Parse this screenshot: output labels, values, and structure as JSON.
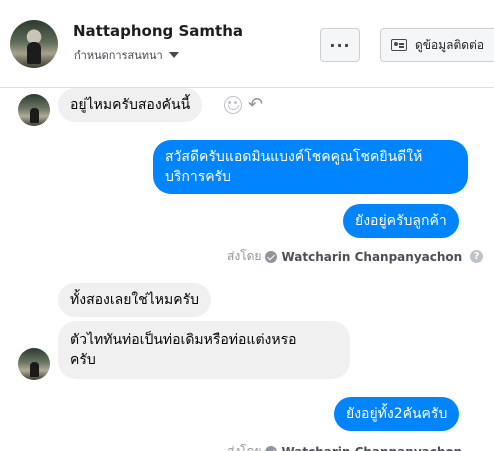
{
  "header": {
    "contact_name": "Nattaphong Samtha",
    "subtitle": "กำหนดการสนทนา",
    "more_label": "···",
    "contact_info_label": "ดูข้อมูลติดต่อ"
  },
  "messages": [
    {
      "side": "in",
      "text": "อยู่ไหมครับสองคันนี้"
    },
    {
      "side": "out",
      "text_line1": "สวัสดีครับแอดมินแบงค์โชคคูณโชคยินดีให้",
      "text_line2": "บริการครับ"
    },
    {
      "side": "out",
      "text": "ยังอยู่ครับลูกค้า"
    },
    {
      "side": "in",
      "text": "ทั้งสองเลยใช่ไหมครับ"
    },
    {
      "side": "in",
      "text_line1": "ตัวไททันท่อเป็นท่อเดิมหรือท่อแต่งหรอ",
      "text_line2": "ครับ"
    },
    {
      "side": "out",
      "text": "ยังอยู่ทั้ง2คันครับ"
    }
  ],
  "sent_by": {
    "prefix": "ส่งโดย",
    "name": "Watcharin Chanpanyachon",
    "info": "?"
  },
  "icons": {
    "react": "smiley-icon",
    "reply": "reply-arrow-icon"
  },
  "colors": {
    "outgoing": "#0084ff",
    "incoming": "#f1f0f0"
  }
}
